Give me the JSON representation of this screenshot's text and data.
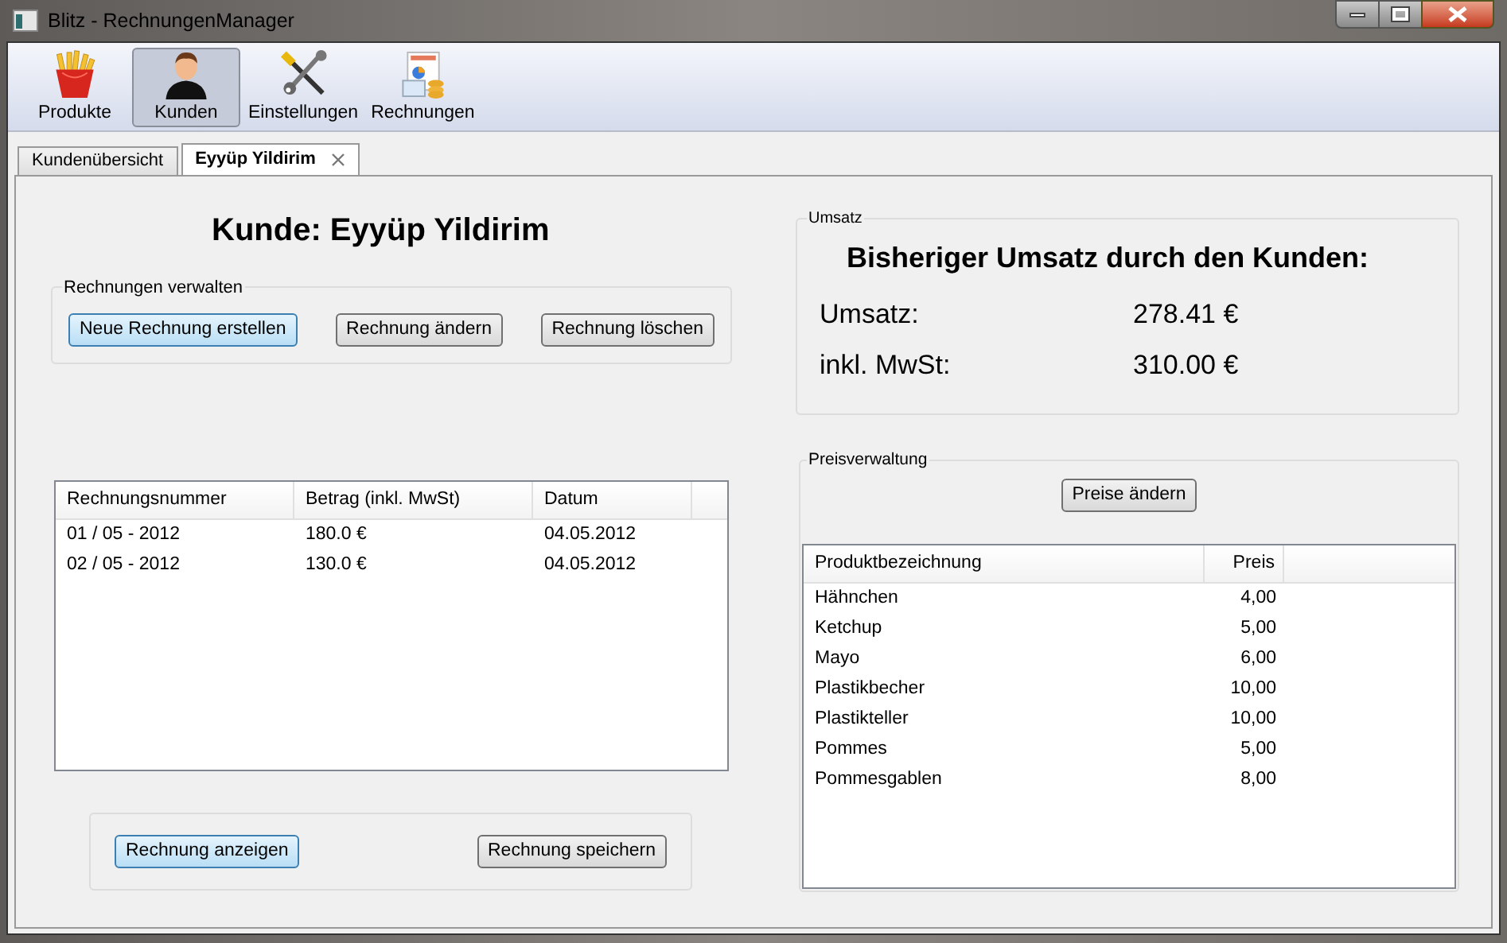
{
  "window": {
    "title": "Blitz - RechnungenManager"
  },
  "toolbar": [
    {
      "label": "Produkte",
      "kind": "fries",
      "selected": false
    },
    {
      "label": "Kunden",
      "kind": "person",
      "selected": true
    },
    {
      "label": "Einstellungen",
      "kind": "tools",
      "selected": false
    },
    {
      "label": "Rechnungen",
      "kind": "documents",
      "selected": false
    }
  ],
  "tabs": [
    {
      "label": "Kundenübersicht",
      "selected": false,
      "closable": false
    },
    {
      "label": "Eyyüp Yildirim",
      "selected": true,
      "closable": true
    }
  ],
  "customer_heading": "Kunde: Eyyüp Yildirim",
  "manage_group": {
    "title": "Rechnungen verwalten",
    "buttons": [
      {
        "label": "Neue Rechnung erstellen",
        "focused": true
      },
      {
        "label": "Rechnung ändern",
        "focused": false
      },
      {
        "label": "Rechnung löschen",
        "focused": false
      }
    ]
  },
  "invoice_table": {
    "columns": [
      "Rechnungsnummer",
      "Betrag (inkl. MwSt)",
      "Datum"
    ],
    "rows": [
      [
        "01 / 05 - 2012",
        "180.0 €",
        "04.05.2012"
      ],
      [
        "02 / 05 - 2012",
        "130.0 €",
        "04.05.2012"
      ]
    ]
  },
  "bottom_buttons": [
    {
      "label": "Rechnung anzeigen",
      "focused": true
    },
    {
      "label": "Rechnung speichern",
      "focused": false
    }
  ],
  "revenue_group": {
    "title": "Umsatz",
    "heading": "Bisheriger Umsatz durch den Kunden:",
    "rows": [
      {
        "label": "Umsatz:",
        "value": "278.41 €"
      },
      {
        "label": "inkl. MwSt:",
        "value": "310.00 €"
      }
    ]
  },
  "price_group": {
    "title": "Preisverwaltung",
    "button": "Preise ändern",
    "columns": [
      "Produktbezeichnung",
      "Preis"
    ],
    "rows": [
      [
        "Hähnchen",
        "4,00"
      ],
      [
        "Ketchup",
        "5,00"
      ],
      [
        "Mayo",
        "6,00"
      ],
      [
        "Plastikbecher",
        "10,00"
      ],
      [
        "Plastikteller",
        "10,00"
      ],
      [
        "Pommes",
        "5,00"
      ],
      [
        "Pommesgablen",
        "8,00"
      ]
    ]
  }
}
